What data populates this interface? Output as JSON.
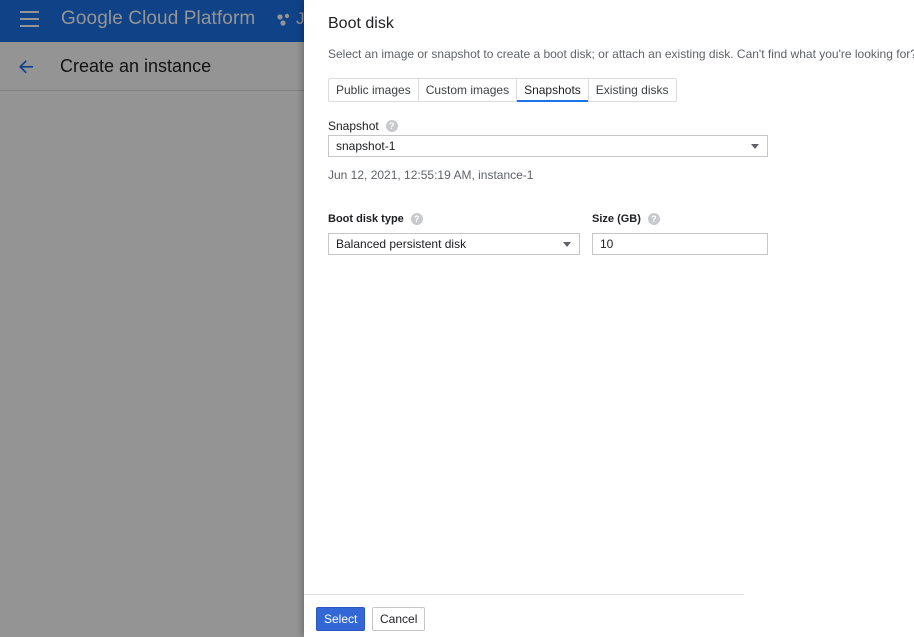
{
  "app": {
    "product_name": "Google Cloud Platform",
    "project_truncated": "J",
    "page_title": "Create an instance"
  },
  "panel": {
    "title": "Boot disk",
    "description": "Select an image or snapshot to create a boot disk; or attach an existing disk. Can't find what you're looking for?",
    "tabs": [
      {
        "label": "Public images",
        "active": false
      },
      {
        "label": "Custom images",
        "active": false
      },
      {
        "label": "Snapshots",
        "active": true
      },
      {
        "label": "Existing disks",
        "active": false
      }
    ],
    "snapshot": {
      "label": "Snapshot",
      "value": "snapshot-1",
      "info": "Jun 12, 2021, 12:55:19 AM, instance-1"
    },
    "disk_type": {
      "label": "Boot disk type",
      "value": "Balanced persistent disk"
    },
    "size": {
      "label": "Size (GB)",
      "value": "10"
    },
    "buttons": {
      "select": "Select",
      "cancel": "Cancel"
    }
  },
  "colors": {
    "brand_blue": "#1a73e8",
    "primary_button": "#3367d6"
  }
}
